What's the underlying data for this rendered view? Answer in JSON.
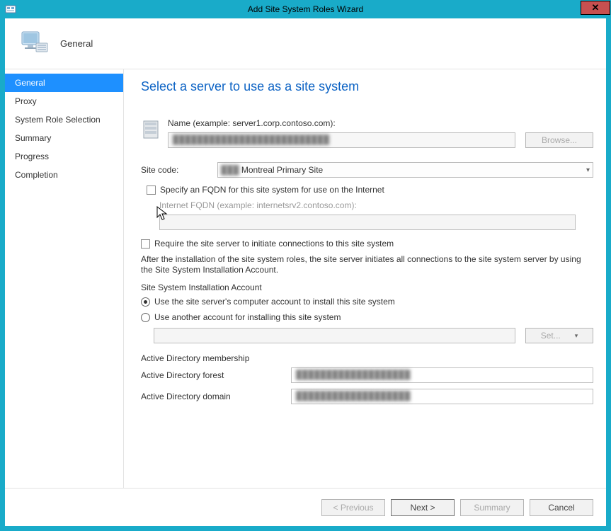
{
  "window": {
    "title": "Add Site System Roles Wizard",
    "close_label": "✕"
  },
  "header": {
    "page_label": "General"
  },
  "nav": {
    "items": [
      {
        "label": "General",
        "selected": true
      },
      {
        "label": "Proxy",
        "selected": false
      },
      {
        "label": "System Role Selection",
        "selected": false
      },
      {
        "label": "Summary",
        "selected": false
      },
      {
        "label": "Progress",
        "selected": false
      },
      {
        "label": "Completion",
        "selected": false
      }
    ]
  },
  "content": {
    "heading": "Select a server to use as a site system",
    "name_caption": "Name (example: server1.corp.contoso.com):",
    "name_value_masked": "██████████████████████████",
    "browse_label": "Browse...",
    "site_code_label": "Site code:",
    "site_code_value_prefix": "███",
    "site_code_value_suffix": "  Montreal Primary Site",
    "specify_fqdn_label": "Specify an FQDN for this site system for use on the Internet",
    "internet_fqdn_caption": "Internet FQDN (example: internetsrv2.contoso.com):",
    "require_initiate_label": "Require the site server to initiate connections to this site system",
    "explain_text": "After the  installation of the site system roles, the site server initiates all connections to the site system server by using the Site System Installation Account.",
    "install_account_heading": "Site System Installation Account",
    "radio_use_computer": "Use the site server's computer account to install this site system",
    "radio_use_other": "Use another account for installing this site system",
    "set_label": "Set...",
    "ad_heading": "Active Directory membership",
    "ad_forest_label": "Active Directory forest",
    "ad_forest_value_masked": "███████████████████",
    "ad_domain_label": "Active Directory domain",
    "ad_domain_value_masked": "███████████████████"
  },
  "footer": {
    "previous": "< Previous",
    "next": "Next >",
    "summary": "Summary",
    "cancel": "Cancel"
  }
}
